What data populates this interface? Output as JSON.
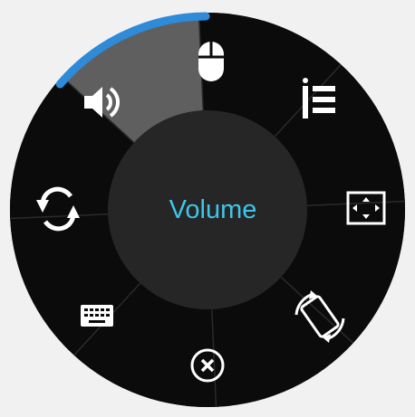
{
  "radial_menu": {
    "center_label": "Volume",
    "selected_item": "volume",
    "colors": {
      "background": "#f1f1f1",
      "ring": "#0b0b0b",
      "hub": "#262626",
      "selected_sector": "#5f5f5f",
      "divider": "#2a2a2a",
      "icon": "#ffffff",
      "accent": "#2f8ad8",
      "center_text": "#3ec6e8"
    },
    "items": [
      {
        "id": "mouse",
        "icon": "mouse-icon"
      },
      {
        "id": "list",
        "icon": "list-icon"
      },
      {
        "id": "fullscreen",
        "icon": "fullscreen-icon"
      },
      {
        "id": "rotate",
        "icon": "rotate-screen-icon"
      },
      {
        "id": "close",
        "icon": "close-icon"
      },
      {
        "id": "keyboard",
        "icon": "keyboard-icon"
      },
      {
        "id": "switch",
        "icon": "swap-arrows-icon"
      },
      {
        "id": "volume",
        "icon": "speaker-icon"
      }
    ]
  }
}
